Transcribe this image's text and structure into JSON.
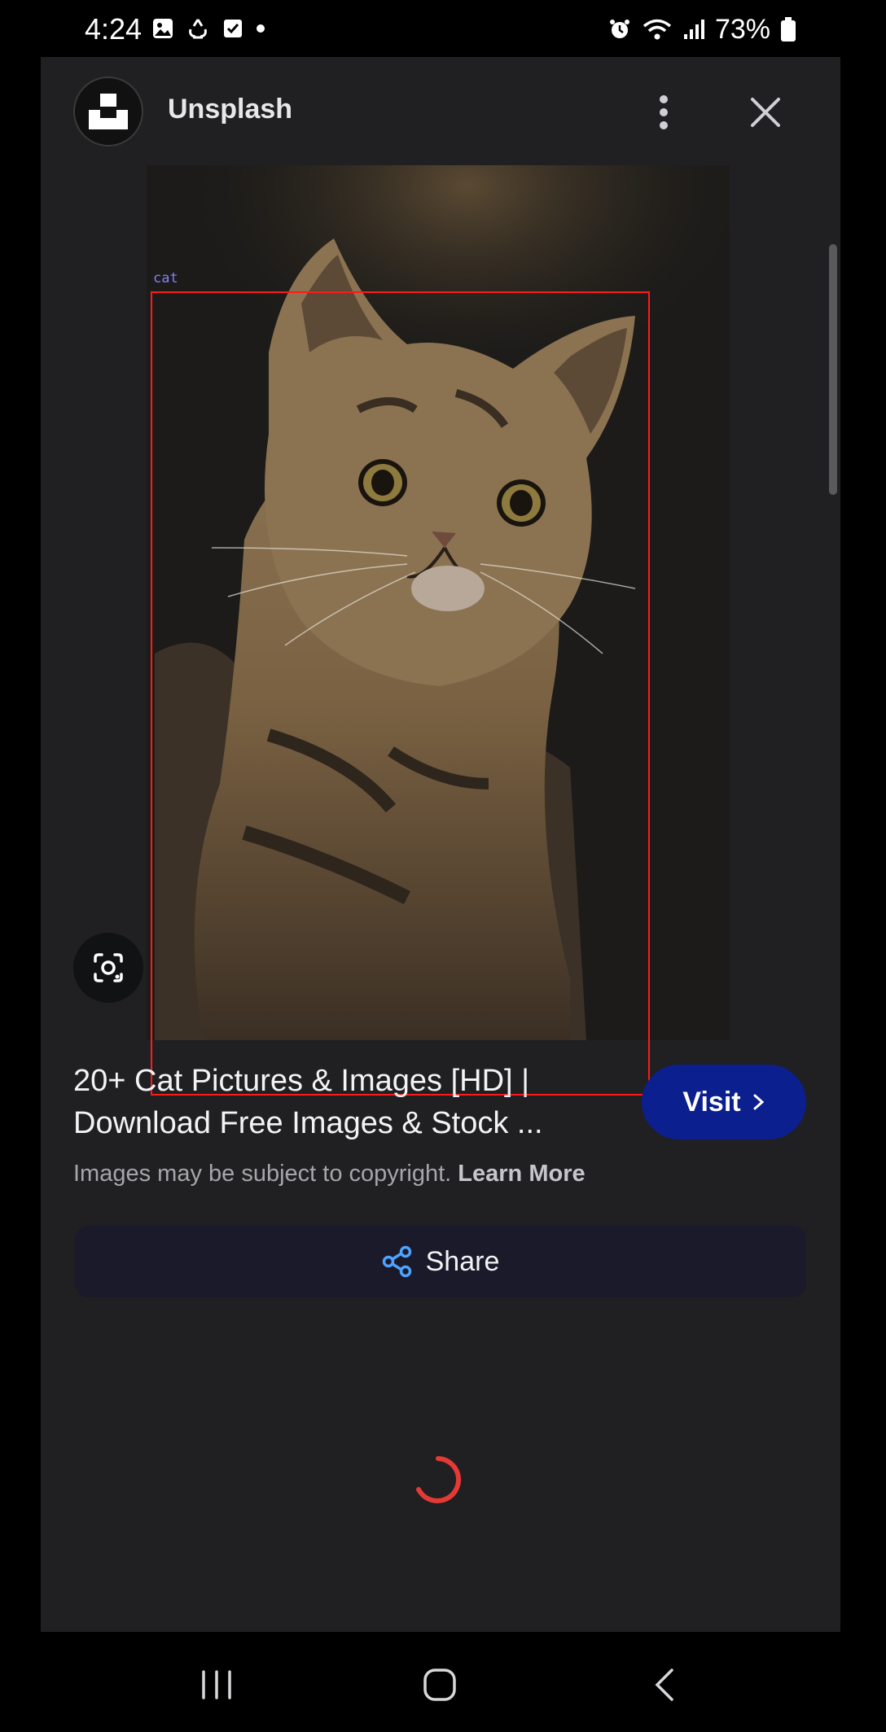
{
  "status_bar": {
    "time": "4:24",
    "battery_percent": "73%",
    "left_icons": [
      "gallery-icon",
      "recycle-icon",
      "task-check-icon",
      "notification-dot-icon"
    ],
    "right_icons": [
      "alarm-icon",
      "wifi-icon",
      "signal-icon",
      "battery-icon"
    ]
  },
  "header": {
    "site_name": "Unsplash",
    "more_icon": "more-vertical-icon",
    "close_icon": "close-icon"
  },
  "image": {
    "detection_label": "cat",
    "detection_box_color": "#ff1a1a",
    "lens_icon": "lens-icon"
  },
  "result": {
    "title": "20+ Cat Pictures & Images [HD] | Download Free Images & Stock ...",
    "visit_label": "Visit",
    "copyright_text": "Images may be subject to copyright.",
    "learn_more": "Learn More"
  },
  "share": {
    "label": "Share",
    "icon": "share-icon"
  },
  "nav_bar": {
    "buttons": [
      "recent-apps-icon",
      "home-icon",
      "back-icon"
    ]
  },
  "colors": {
    "accent_visit": "#0b1f8f",
    "spinner": "#e53935",
    "share_icon": "#4da3ff"
  }
}
